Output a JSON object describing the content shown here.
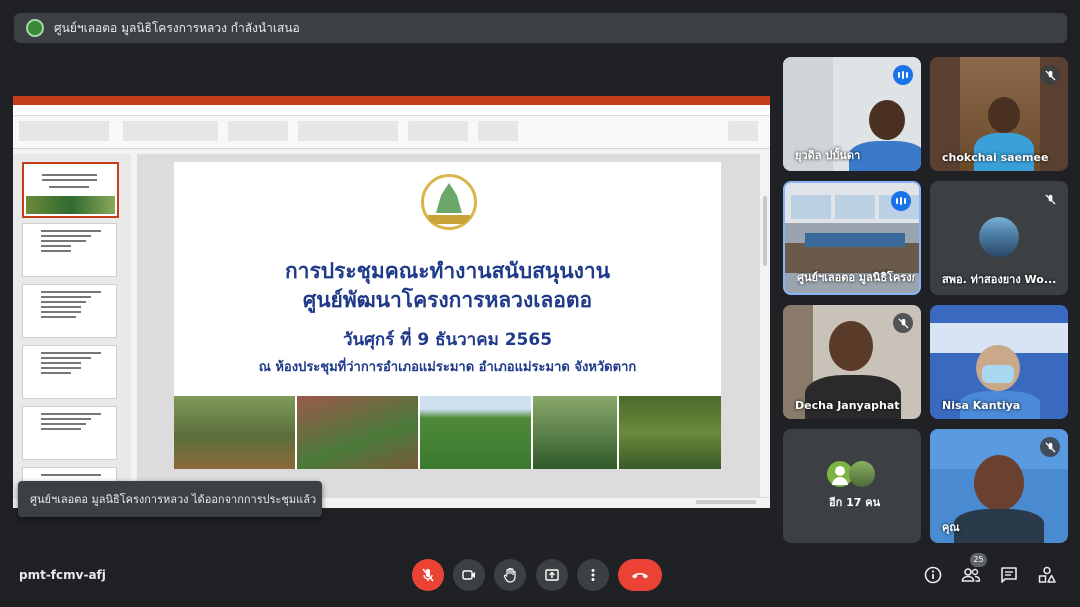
{
  "meeting": {
    "presenter_banner": "ศูนย์ฯเลอตอ มูลนิธิโครงการหลวง กำลังนำเสนอ",
    "code": "pmt-fcmv-afj",
    "people_count": "25"
  },
  "slide": {
    "line1": "การประชุมคณะทำงานสนับสนุนงาน",
    "line2": "ศูนย์พัฒนาโครงการหลวงเลอตอ",
    "date": "วันศุกร์ ที่  9  ธันวาคม 2565",
    "place": "ณ ห้องประชุมที่ว่าการอำเภอแม่ระมาด  อำเภอแม่ระมาด จังหวัดตาก",
    "emblem_text": "โครงการหลวง"
  },
  "toast": {
    "message": "ศูนย์ฯเลอตอ มูลนิธิโครงการหลวง ได้ออกจากการประชุมแล้ว"
  },
  "participants": [
    {
      "name": "ยุวดิล ปบั้นดา",
      "muted": false,
      "speaking": true
    },
    {
      "name": "chokchai saemee",
      "muted": true
    },
    {
      "name": "ศูนย์ฯเลอตอ มูลนิธิโครงการหลวง",
      "muted": false,
      "speaking": true
    },
    {
      "name": "สพอ. ท่าสองยาง Wo...",
      "muted": true
    },
    {
      "name": "Decha Janyaphat",
      "muted": true
    },
    {
      "name": "Nisa Kantiya",
      "muted": true
    },
    {
      "name": "อีก 17 คน"
    },
    {
      "name": "คุณ",
      "muted": true
    }
  ],
  "colors": {
    "background": "#202124",
    "tile": "#3c4043",
    "hangup": "#ea4335",
    "speaking": "#1a73e8",
    "slide_text": "#1f3a8a",
    "ppt_accent": "#c43e1c"
  },
  "icons": {
    "mic": "mic-off-icon",
    "camera": "camera-icon",
    "hand": "raise-hand-icon",
    "present": "present-icon",
    "more": "more-options-icon",
    "end": "hang-up-icon",
    "info": "info-icon",
    "people": "people-icon",
    "chat": "chat-icon",
    "activities": "activities-icon"
  }
}
